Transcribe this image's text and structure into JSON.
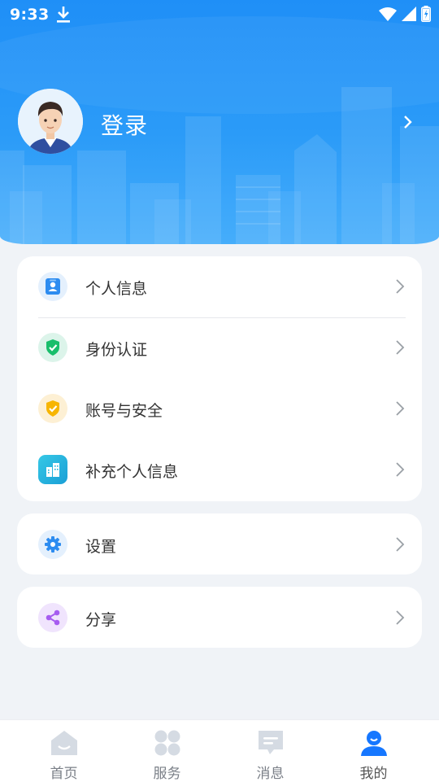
{
  "status_bar": {
    "time": "9:33"
  },
  "profile": {
    "login_label": "登录"
  },
  "menu_group_1": [
    {
      "label": "个人信息",
      "icon": "id-card-icon",
      "color": "#2d8cf0"
    },
    {
      "label": "身份认证",
      "icon": "shield-check-icon",
      "color": "#19be6b"
    },
    {
      "label": "账号与安全",
      "icon": "shield-lock-icon",
      "color": "#f7b500"
    },
    {
      "label": "补充个人信息",
      "icon": "building-icon",
      "color": "#1fb3d8"
    }
  ],
  "menu_group_2": [
    {
      "label": "设置",
      "icon": "gear-icon",
      "color": "#2d8cf0"
    }
  ],
  "menu_group_3": [
    {
      "label": "分享",
      "icon": "share-icon",
      "color": "#a65cf0"
    }
  ],
  "tabs": [
    {
      "label": "首页",
      "icon": "home-icon"
    },
    {
      "label": "服务",
      "icon": "grid-icon"
    },
    {
      "label": "消息",
      "icon": "message-icon"
    },
    {
      "label": "我的",
      "icon": "user-icon",
      "active": true
    }
  ],
  "colors": {
    "header_blue": "#1f8ff7",
    "accent": "#1677ff",
    "inactive_tab": "#d5dbe3"
  }
}
